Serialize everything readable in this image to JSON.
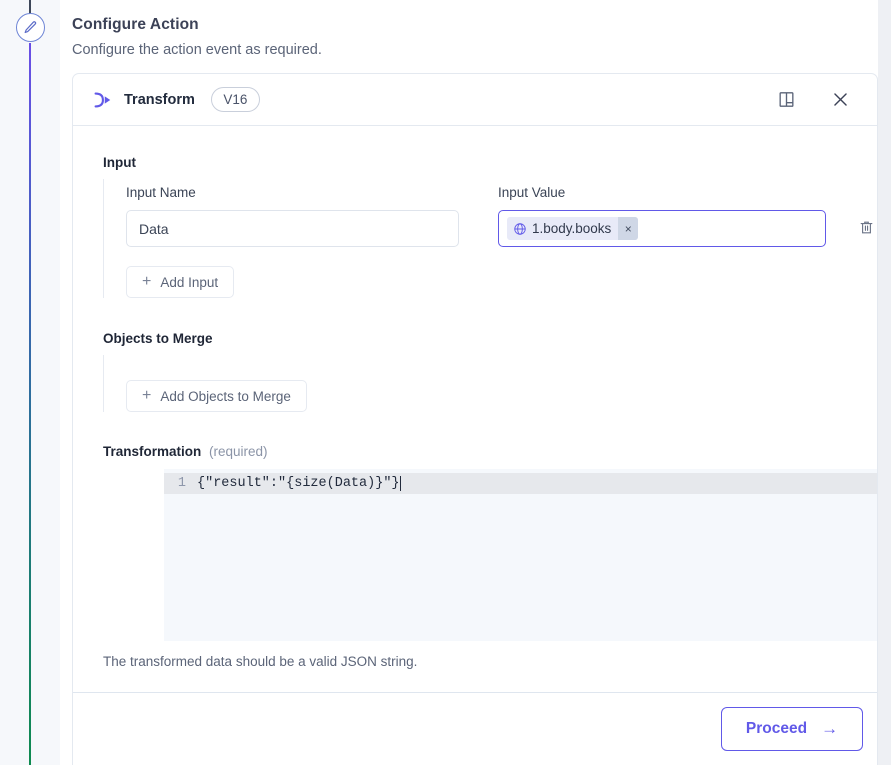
{
  "page": {
    "title": "Configure Action",
    "subtitle": "Configure the action event as required."
  },
  "rail": {
    "node_icon": "pencil-icon",
    "gradient": [
      "#6b4ee6",
      "#2d6f9c",
      "#0e8a4f"
    ]
  },
  "card": {
    "header": {
      "icon": "transform-icon",
      "name": "Transform",
      "version": "V16",
      "docs_icon": "book-icon",
      "close_icon": "close-icon"
    },
    "sections": {
      "input": {
        "label": "Input",
        "columns": {
          "name": "Input Name",
          "value": "Input Value"
        },
        "rows": [
          {
            "name_value": "Data",
            "name_placeholder": "Input Name",
            "chip": {
              "icon": "globe-icon",
              "text": "1.body.books",
              "remove": "×"
            },
            "delete_icon": "trash-icon"
          }
        ],
        "add_label": "Add Input",
        "add_icon": "plus-icon"
      },
      "merge": {
        "label": "Objects to Merge",
        "add_label": "Add Objects to Merge",
        "add_icon": "plus-icon"
      },
      "transformation": {
        "label": "Transformation",
        "required_note": "(required)",
        "line_number": "1",
        "code": "{\"result\":\"{size(Data)}\"}",
        "hint": "The transformed data should be a valid JSON string."
      }
    },
    "footer": {
      "proceed_label": "Proceed",
      "proceed_arrow": "→"
    }
  },
  "colors": {
    "accent": "#6159e8",
    "chip_bg": "#e8eaf8",
    "editor_bg": "#f5f8fc",
    "rail_bg": "#f6f8fb"
  }
}
